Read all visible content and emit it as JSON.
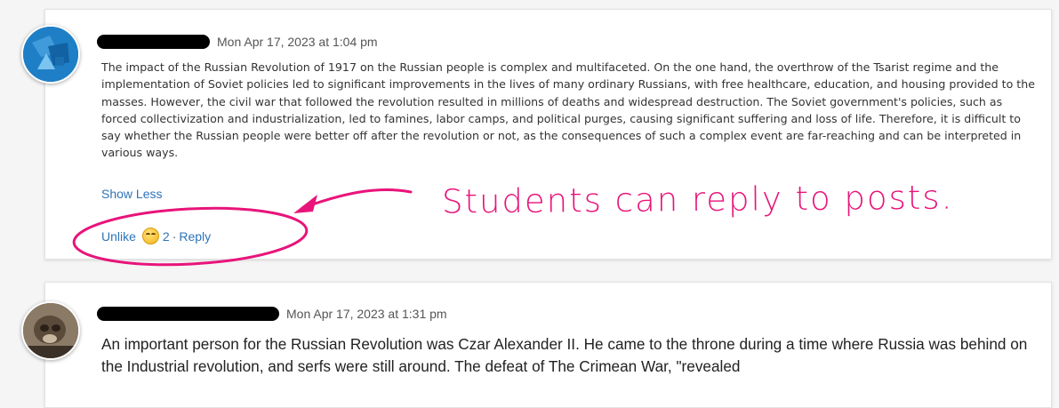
{
  "posts": [
    {
      "timestamp": "Mon Apr 17, 2023 at 1:04 pm",
      "body": "The impact of the Russian Revolution of 1917 on the Russian people is complex and multifaceted. On the one hand, the overthrow of the Tsarist regime and the implementation of Soviet policies led to significant improvements in the lives of many ordinary Russians, with free healthcare, education, and housing provided to the masses. However, the civil war that followed the revolution resulted in millions of deaths and widespread destruction. The Soviet government's policies, such as forced collectivization and industrialization, led to famines, labor camps, and political purges, causing significant suffering and loss of life. Therefore, it is difficult to say whether the Russian people were better off after the revolution or not, as the consequences of such a complex event are far-reaching and can be interpreted in various ways.",
      "show_less_label": "Show Less",
      "unlike_label": "Unlike",
      "like_count": "2",
      "separator": "·",
      "reply_label": "Reply"
    },
    {
      "timestamp": "Mon Apr 17, 2023 at 1:31 pm",
      "body": "An important person for the Russian Revolution was Czar Alexander II. He came to the throne during a time where Russia was behind on the Industrial revolution, and serfs were still around. The defeat of The Crimean War, \"revealed"
    }
  ],
  "annotation": {
    "text": "Students can reply to posts.",
    "color": "#e8147a"
  },
  "colors": {
    "link": "#2d73b8",
    "background": "#f5f5f5"
  }
}
